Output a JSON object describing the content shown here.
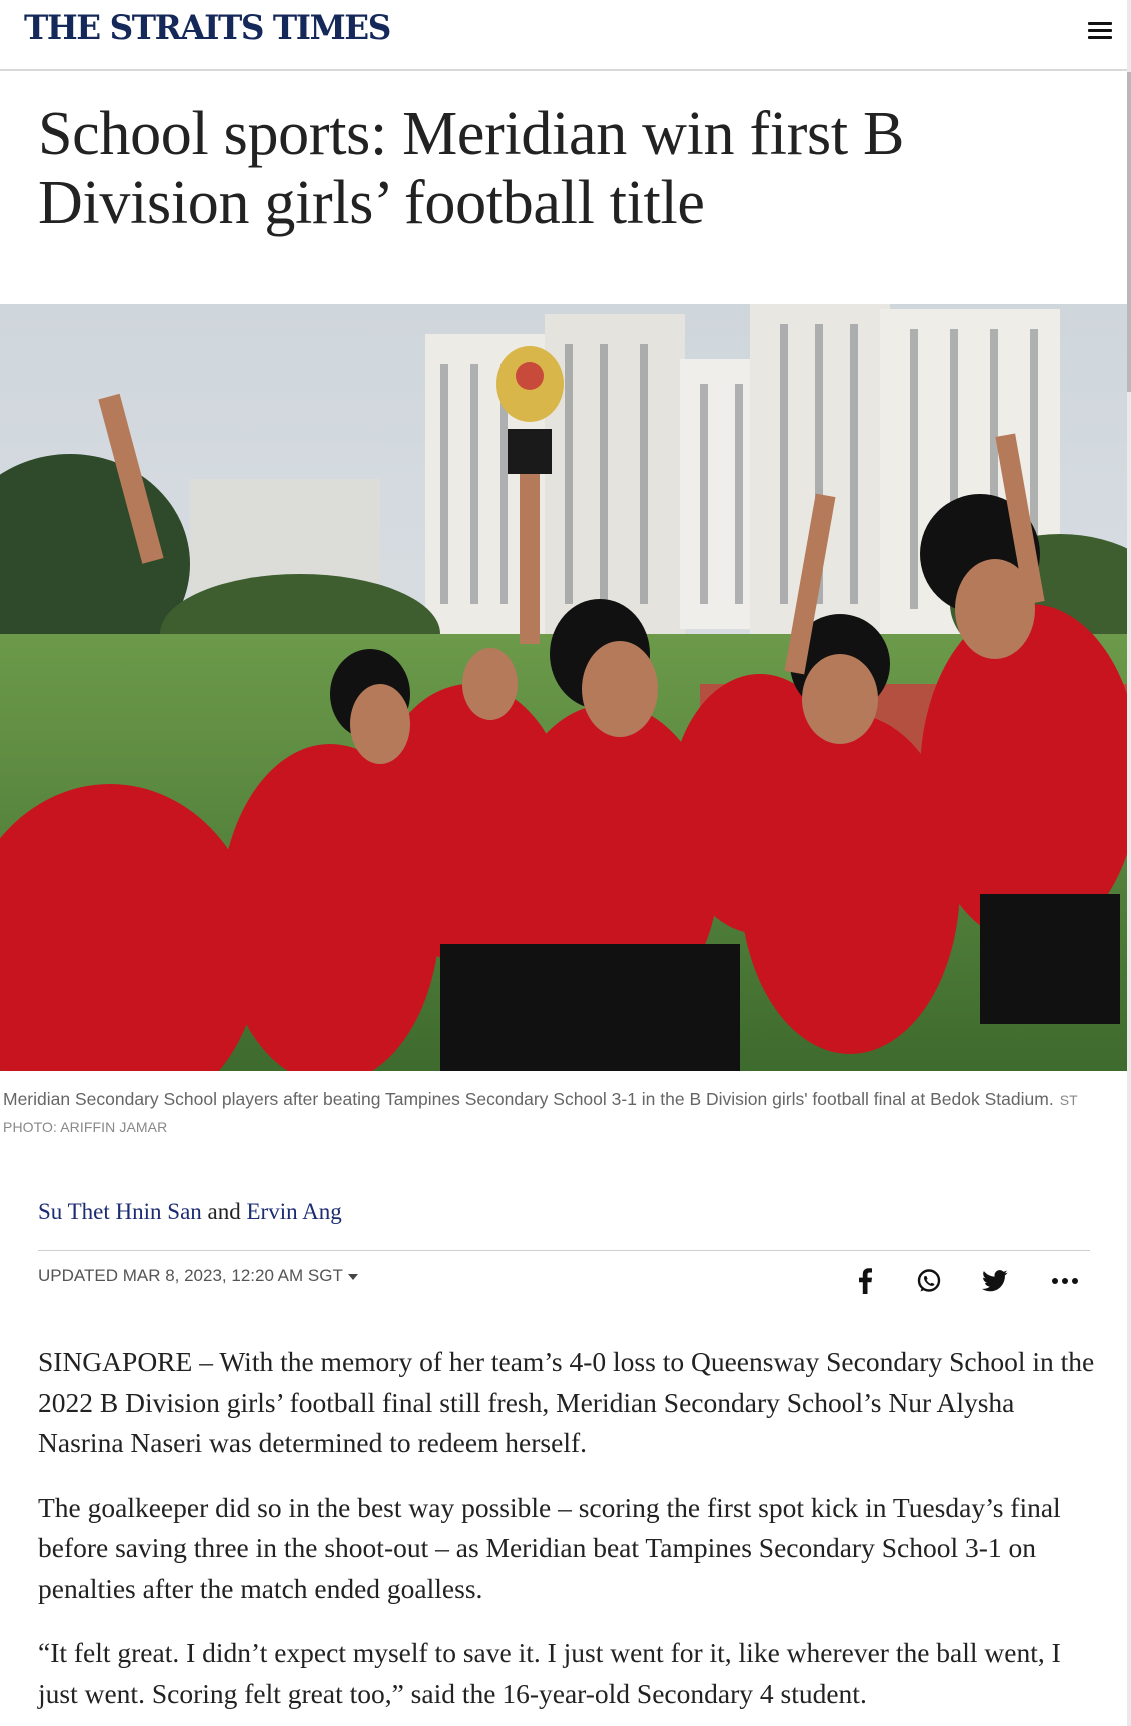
{
  "header": {
    "logo_text": "THE STRAITS TIMES",
    "menu_icon": "hamburger-menu-icon",
    "brand_color": "#15285a"
  },
  "article": {
    "headline": "School sports: Meridian win first B Division girls’ football title",
    "image": {
      "description_icon": "photo",
      "caption": "Meridian Secondary School players after beating Tampines Secondary School 3-1 in the B Division girls' football final at Bedok Stadium.",
      "credit": "ST PHOTO: ARIFFIN JAMAR"
    },
    "byline": {
      "author1": "Su Thet Hnin San",
      "conjunction": "and",
      "author2": "Ervin Ang"
    },
    "updated": "UPDATED MAR 8, 2023, 12:20 AM SGT",
    "share": {
      "icons": [
        "facebook-icon",
        "whatsapp-icon",
        "twitter-icon",
        "more-icon"
      ]
    },
    "paragraphs": [
      "SINGAPORE – With the memory of her team’s 4-0 loss to Queensway Secondary School in the 2022 B Division girls’ football final still fresh, Meridian Secondary School’s Nur Alysha Nasrina Naseri was determined to redeem herself.",
      "The goalkeeper did so in the best way possible – scoring the first spot kick in Tuesday’s final before saving three in the shoot-out – as Meridian beat Tampines Secondary School 3-1 on penalties after the match ended goalless.",
      "“It felt great. I didn’t expect myself to save it. I just went for it, like wherever the ball went, I just went. Scoring felt great too,” said the 16-year-old Secondary 4 student."
    ]
  }
}
